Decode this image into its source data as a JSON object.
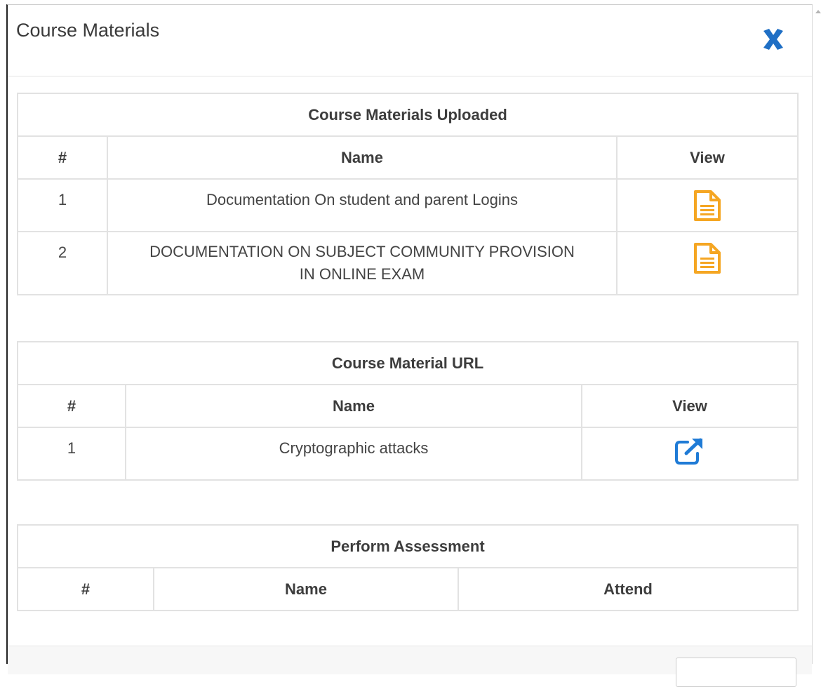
{
  "modal": {
    "title": "Course Materials"
  },
  "uploaded": {
    "title": "Course Materials Uploaded",
    "columns": [
      "#",
      "Name",
      "View"
    ],
    "rows": [
      {
        "num": "1",
        "name": "Documentation On student and parent Logins",
        "icon": "file-text-icon"
      },
      {
        "num": "2",
        "name": "DOCUMENTATION ON SUBJECT COMMUNITY PROVISION IN ONLINE EXAM",
        "icon": "file-text-icon"
      }
    ]
  },
  "urls": {
    "title": "Course Material URL",
    "columns": [
      "#",
      "Name",
      "View"
    ],
    "rows": [
      {
        "num": "1",
        "name": "Cryptographic attacks",
        "icon": "external-link-icon"
      }
    ]
  },
  "assessment": {
    "title": "Perform Assessment",
    "columns": [
      "#",
      "Name",
      "Attend"
    ]
  },
  "colors": {
    "close": "#1f6fc5",
    "file_icon": "#f5a623",
    "link_icon": "#1f7bd6",
    "border": "#e2e2e2"
  }
}
